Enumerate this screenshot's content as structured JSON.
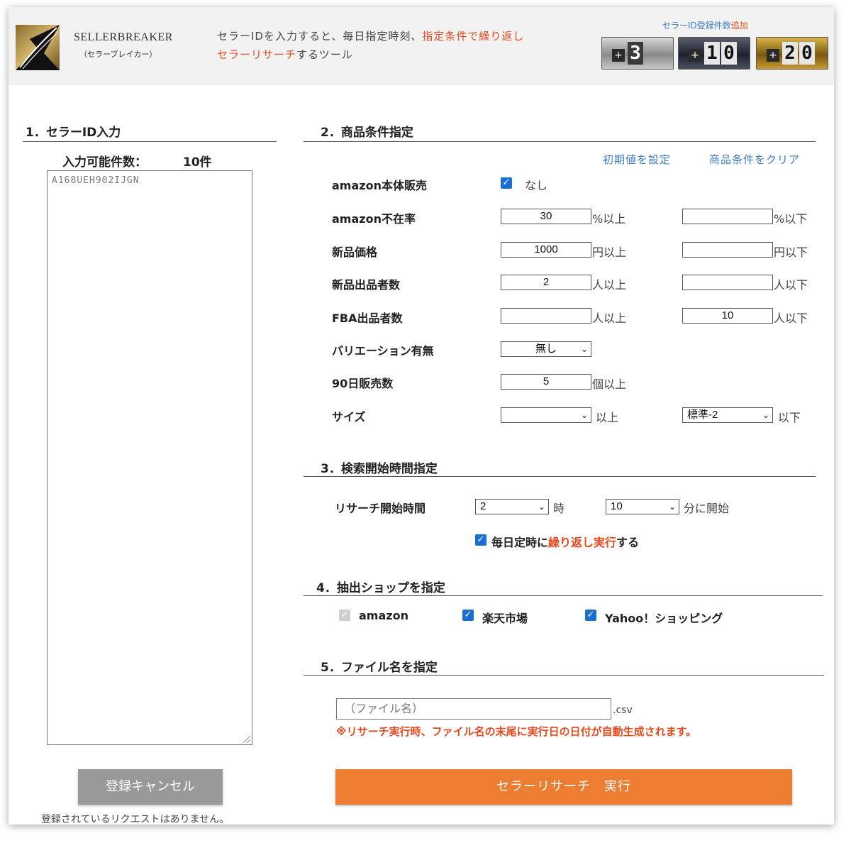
{
  "header": {
    "brand_name": "SELLERBREAKER",
    "brand_sub": "（セラーブレイカー）",
    "tagline_1_normal": "セラーIDを入力すると、毎日指定時刻、",
    "tagline_1_red": "指定条件で繰り返し",
    "tagline_2_red": "セラーリサーチ",
    "tagline_2_normal": "するツール",
    "counter_title": "セラーID登録件数",
    "counter_title_red": "追加",
    "counters": [
      {
        "plus": "+",
        "digits": [
          "3"
        ]
      },
      {
        "plus": "+",
        "digits": [
          "1",
          "0"
        ]
      },
      {
        "plus": "+",
        "digits": [
          "2",
          "0"
        ]
      }
    ]
  },
  "section1": {
    "title": "1．セラーID入力",
    "capacity_label": "入力可能件数：",
    "capacity_value": "10件",
    "textarea_value": "A168UEH902IJGN"
  },
  "section2": {
    "title": "2．商品条件指定",
    "link_default": "初期値を設定",
    "link_clear": "商品条件をクリア",
    "amazon_self_label": "amazon本体販売",
    "amazon_self_option": "なし",
    "amazon_absence_label": "amazon不在率",
    "amazon_absence_min": "30",
    "amazon_absence_min_unit": "%以上",
    "amazon_absence_max": "",
    "amazon_absence_max_unit": "%以下",
    "new_price_label": "新品価格",
    "new_price_min": "1000",
    "new_price_min_unit": "円以上",
    "new_price_max": "",
    "new_price_max_unit": "円以下",
    "new_sellers_label": "新品出品者数",
    "new_sellers_min": "2",
    "new_sellers_min_unit": "人以上",
    "new_sellers_max": "",
    "new_sellers_max_unit": "人以下",
    "fba_sellers_label": "FBA出品者数",
    "fba_sellers_min": "",
    "fba_sellers_min_unit": "人以上",
    "fba_sellers_max": "10",
    "fba_sellers_max_unit": "人以下",
    "variation_label": "バリエーション有無",
    "variation_value": "無し",
    "sales90_label": "90日販売数",
    "sales90_min": "5",
    "sales90_unit": "個以上",
    "size_label": "サイズ",
    "size_min": "",
    "size_min_unit": "以上",
    "size_max": "標準-2",
    "size_max_unit": "以下"
  },
  "section3": {
    "title": "3．検索開始時間指定",
    "start_label": "リサーチ開始時間",
    "hour_value": "2",
    "hour_unit": "時",
    "minute_value": "10",
    "minute_unit": "分に開始",
    "repeat_prefix": "毎日定時に",
    "repeat_red": "繰り返し実行",
    "repeat_suffix": "する"
  },
  "section4": {
    "title": "4．抽出ショップを指定",
    "shop_amazon": "amazon",
    "shop_rakuten": "楽天市場",
    "shop_yahoo": "Yahoo！ショッピング"
  },
  "section5": {
    "title": "5．ファイル名を指定",
    "file_placeholder": "（ファイル名）",
    "file_ext": ".csv",
    "note": "※リサーチ実行時、ファイル名の末尾に実行日の日付が自動生成されます。"
  },
  "buttons": {
    "cancel": "登録キャンセル",
    "execute": "セラーリサーチ　実行",
    "no_request": "登録されているリクエストはありません。"
  },
  "colors": {
    "accent_red": "#e8491d",
    "link_blue": "#3c7bc5",
    "execute_orange": "#ed7d31",
    "checkbox_blue": "#1a6fd1"
  }
}
